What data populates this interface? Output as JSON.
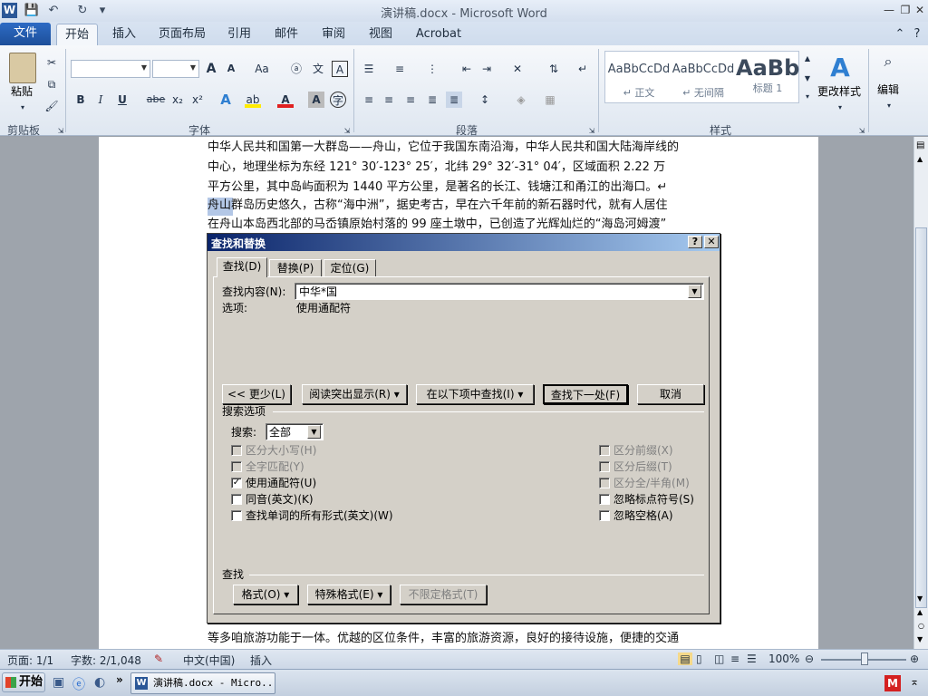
{
  "window": {
    "title": "演讲稿.docx - Microsoft Word",
    "app_icon": "W"
  },
  "ribbon": {
    "tabs": [
      "文件",
      "开始",
      "插入",
      "页面布局",
      "引用",
      "邮件",
      "审阅",
      "视图",
      "Acrobat"
    ],
    "active_tab": "开始",
    "groups": {
      "clipboard": "剪贴板",
      "font": "字体",
      "paragraph": "段落",
      "styles": "样式",
      "editing": "编辑"
    },
    "paste_label": "粘贴",
    "change_styles_label": "更改样式",
    "edit_label": "编辑",
    "styles": [
      {
        "preview": "AaBbCcDd",
        "name": "↵ 正文"
      },
      {
        "preview": "AaBbCcDd",
        "name": "↵ 无间隔"
      },
      {
        "preview": "AaBb",
        "name": "标题 1"
      }
    ],
    "font_buttons": {
      "bold": "B",
      "italic": "I",
      "underline": "U",
      "strike": "abe",
      "sub": "x₂",
      "sup": "x²",
      "grow": "A",
      "shrink": "A",
      "aa": "Aa"
    }
  },
  "document": {
    "lines": [
      "中华人民共和国第一大群岛——舟山，它位于我国东南沿海，中华人民共和国大陆海岸线的",
      "中心，地理坐标为东经 121° 30′-123° 25′，北纬 29° 32′-31° 04′，区域面积 2.22 万",
      "平方公里，其中岛屿面积为 1440 平方公里，是著名的长江、钱塘江和甬江的出海口。↵",
      "舟山群岛历史悠久，古称“海中洲”，据史考古，早在六千年前的新石器时代，就有人居住",
      "在舟山本岛西北部的马岙镇原始村落的 99 座土墩中，已创造了光辉灿烂的“海岛河姆渡”",
      "等多咱旅游功能于一体。优越的区位条件，丰富的旅游资源，良好的接待设施，便捷的交通"
    ]
  },
  "dialog": {
    "title": "查找和替换",
    "help": "?",
    "close": "✕",
    "tabs": [
      "查找(D)",
      "替换(P)",
      "定位(G)"
    ],
    "find_label": "查找内容(N):",
    "find_value": "中华*国",
    "options_label": "选项:",
    "options_value": "使用通配符",
    "buttons": {
      "less": "<< 更少(L)",
      "highlight": "阅读突出显示(R) ▾",
      "find_in": "在以下项中查找(I) ▾",
      "find_next": "查找下一处(F)",
      "cancel": "取消"
    },
    "search_options_title": "搜索选项",
    "search_label": "搜索:",
    "search_value": "全部",
    "left_checks": [
      {
        "label": "区分大小写(H)",
        "checked": false,
        "disabled": true
      },
      {
        "label": "全字匹配(Y)",
        "checked": false,
        "disabled": true
      },
      {
        "label": "使用通配符(U)",
        "checked": true,
        "disabled": false
      },
      {
        "label": "同音(英文)(K)",
        "checked": false,
        "disabled": false
      },
      {
        "label": "查找单词的所有形式(英文)(W)",
        "checked": false,
        "disabled": false
      }
    ],
    "right_checks": [
      {
        "label": "区分前缀(X)",
        "checked": false,
        "disabled": true
      },
      {
        "label": "区分后缀(T)",
        "checked": false,
        "disabled": true
      },
      {
        "label": "区分全/半角(M)",
        "checked": false,
        "disabled": true
      },
      {
        "label": "忽略标点符号(S)",
        "checked": false,
        "disabled": false
      },
      {
        "label": "忽略空格(A)",
        "checked": false,
        "disabled": false
      }
    ],
    "find_section_title": "查找",
    "format_buttons": [
      "格式(O) ▾",
      "特殊格式(E) ▾",
      "不限定格式(T)"
    ]
  },
  "statusbar": {
    "page": "页面: 1/1",
    "words": "字数: 2/1,048",
    "language": "中文(中国)",
    "mode": "插入",
    "zoom": "100%"
  },
  "taskbar": {
    "start": "开始",
    "task": "演讲稿.docx - Micro..."
  },
  "colors": {
    "accent": "#1d4f9a",
    "dialog_title": "#0a246a",
    "dialog_bg": "#d4d0c8"
  }
}
